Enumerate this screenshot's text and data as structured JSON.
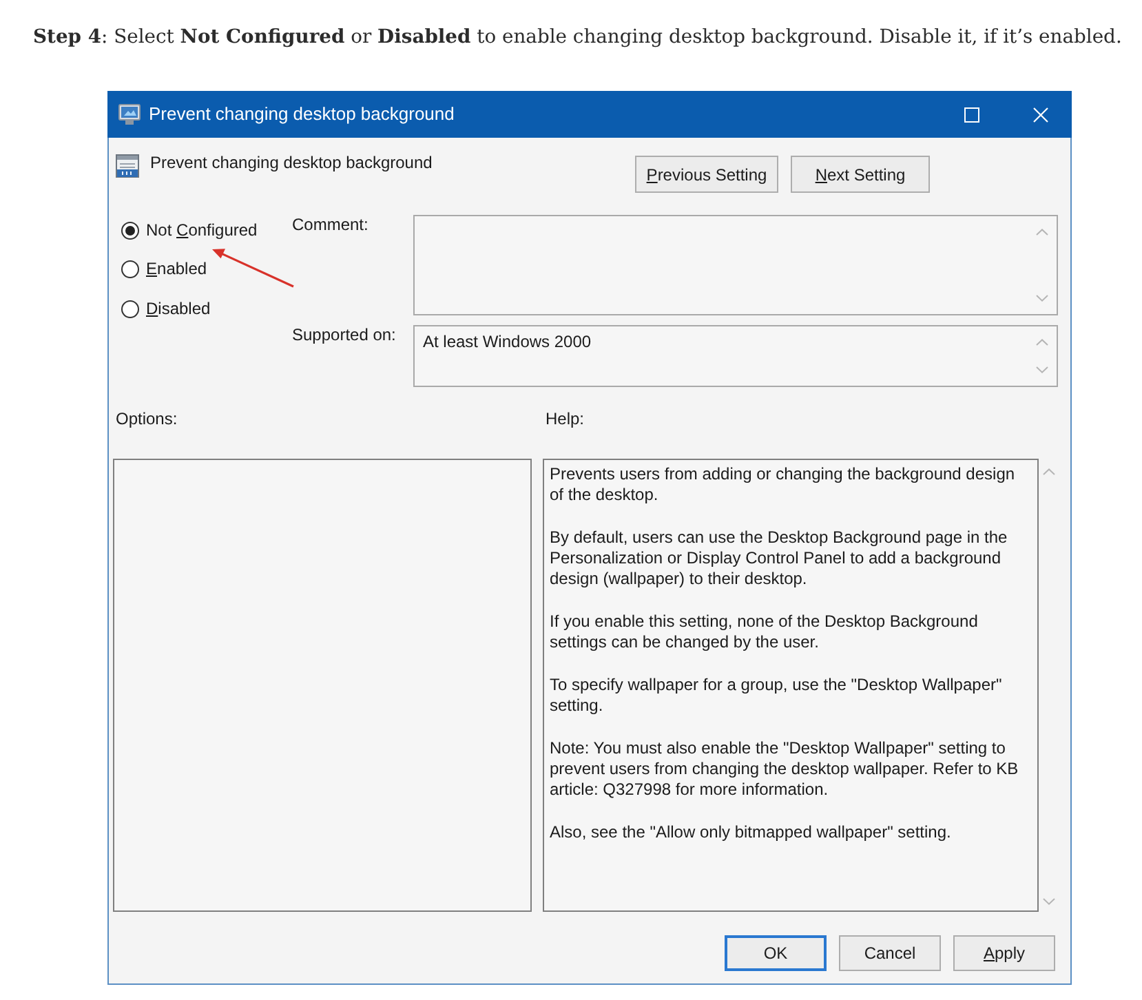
{
  "caption": {
    "text": "**Step 4**: Select **Not Configured** or **Disabled** to enable changing desktop background. Disable it, if it’s enabled."
  },
  "window": {
    "title": "Prevent changing desktop background"
  },
  "header": {
    "setting_name": "Prevent changing desktop background",
    "buttons": [
      {
        "label_parts": [
          {
            "text": "P",
            "access_key": true
          },
          {
            "text": "revious Setting",
            "access_key": false
          }
        ]
      },
      {
        "label_parts": [
          {
            "text": "N",
            "access_key": true
          },
          {
            "text": "ext Setting",
            "access_key": false
          }
        ]
      }
    ]
  },
  "state_options": [
    {
      "label_parts": [
        {
          "text": "Not ",
          "access_key": false
        },
        {
          "text": "C",
          "access_key": true
        },
        {
          "text": "onfigured",
          "access_key": false
        }
      ],
      "selected": true
    },
    {
      "label_parts": [
        {
          "text": "E",
          "access_key": true
        },
        {
          "text": "nabled",
          "access_key": false
        }
      ],
      "selected": false
    },
    {
      "label_parts": [
        {
          "text": "D",
          "access_key": true
        },
        {
          "text": "isabled",
          "access_key": false
        }
      ],
      "selected": false
    }
  ],
  "comment": {
    "label": "Comment:"
  },
  "supported_on": {
    "label": "Supported on:",
    "value": "At least Windows 2000"
  },
  "options": {
    "label": "Options:"
  },
  "help": {
    "label": "Help:",
    "paragraphs": [
      "Prevents users from adding or changing the background design of the desktop.",
      "By default, users can use the Desktop Background page in the Personalization or Display Control Panel to add a background design (wallpaper) to their desktop.",
      "If you enable this setting, none of the Desktop Background settings can be changed by the user.",
      "To specify wallpaper for a group, use the \"Desktop Wallpaper\" setting.",
      "Note: You must also enable the \"Desktop Wallpaper\" setting to prevent users from changing the desktop wallpaper. Refer to KB article: Q327998 for more information.",
      "Also, see the \"Allow only bitmapped wallpaper\" setting."
    ]
  },
  "buttons": [
    {
      "label_parts": [
        {
          "text": "OK",
          "access_key": false
        }
      ],
      "default": true
    },
    {
      "label_parts": [
        {
          "text": "Cancel",
          "access_key": false
        }
      ],
      "default": false
    },
    {
      "label_parts": [
        {
          "text": "A",
          "access_key": true
        },
        {
          "text": "pply",
          "access_key": false
        }
      ],
      "default": false
    }
  ]
}
